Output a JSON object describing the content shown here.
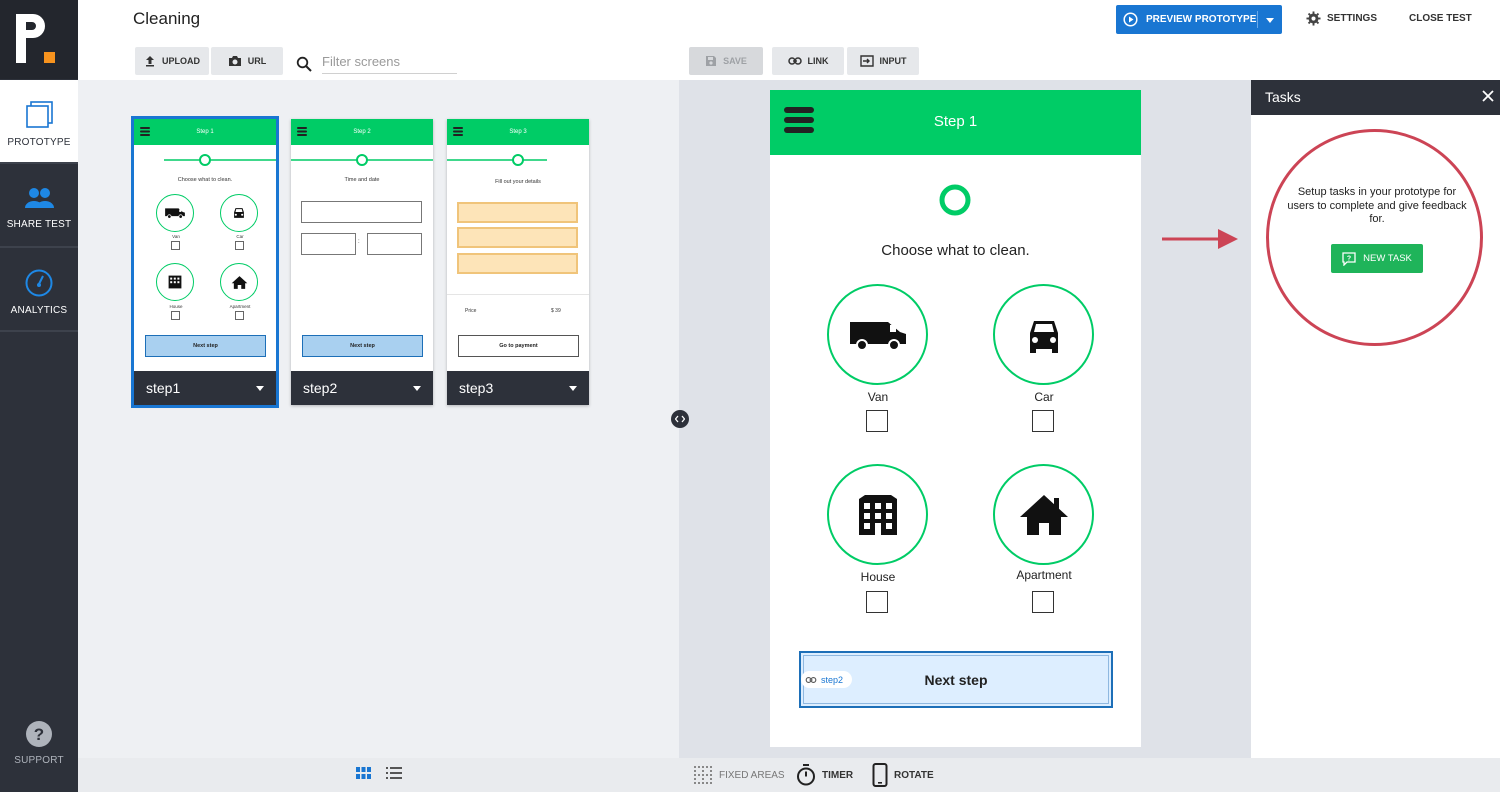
{
  "sidebar": {
    "logo": "P.",
    "items": [
      {
        "label": "PROTOTYPE"
      },
      {
        "label": "SHARE TEST"
      },
      {
        "label": "ANALYTICS"
      }
    ],
    "support": "SUPPORT"
  },
  "header": {
    "title": "Cleaning",
    "upload": "UPLOAD",
    "url": "URL",
    "filter_placeholder": "Filter screens",
    "save": "SAVE",
    "link": "LINK",
    "input": "INPUT",
    "preview": "PREVIEW PROTOTYPE",
    "settings": "SETTINGS",
    "close_test": "CLOSE TEST"
  },
  "screens": [
    {
      "name": "step1",
      "header_title": "Step 1",
      "heading": "Choose what to clean.",
      "options": [
        "Van",
        "Car",
        "House",
        "Apartment"
      ],
      "button": "Next step"
    },
    {
      "name": "step2",
      "header_title": "Step 2",
      "heading": "Time and date",
      "separator": ":",
      "button": "Next step"
    },
    {
      "name": "step3",
      "header_title": "Step 3",
      "heading": "Fill out your details",
      "price_label": "Price",
      "price_value": "$ 39",
      "button": "Go to payment"
    }
  ],
  "editor": {
    "title": "Step 1",
    "heading": "Choose what to clean.",
    "options": [
      {
        "label": "Van",
        "icon": "van-icon"
      },
      {
        "label": "Car",
        "icon": "car-icon"
      },
      {
        "label": "House",
        "icon": "house-icon"
      },
      {
        "label": "Apartment",
        "icon": "apartment-icon"
      }
    ],
    "button": "Next step",
    "link_target": "step2"
  },
  "tasks": {
    "title": "Tasks",
    "description": "Setup tasks in your prototype for users to complete and give feedback for.",
    "new_task": "NEW TASK"
  },
  "footer": {
    "fixed_areas": "FIXED AREAS",
    "timer": "TIMER",
    "rotate": "ROTATE"
  },
  "colors": {
    "accent": "#1976d2",
    "brand_green": "#00cc66",
    "sidebar": "#2d313a",
    "highlight": "#cc4455",
    "logo_dot": "#f7931e"
  }
}
